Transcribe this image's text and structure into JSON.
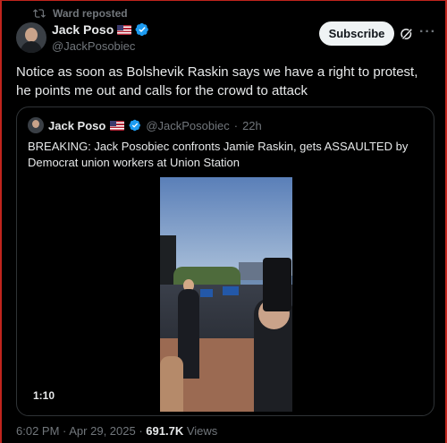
{
  "repost": {
    "text": "Ward reposted",
    "icon": "repost-icon"
  },
  "author": {
    "name": "Jack Poso",
    "handle": "@JackPosobiec",
    "flag": "🇺🇸",
    "verified": true
  },
  "actions": {
    "subscribe_label": "Subscribe",
    "grok_icon": "grok-icon",
    "more_label": "···"
  },
  "post": {
    "text": "Notice as soon as Bolshevik Raskin says we have a right to protest, he points me out and calls for the crowd to attack"
  },
  "quote": {
    "name": "Jack Poso",
    "handle": "@JackPosobiec",
    "separator": "·",
    "time": "22h",
    "text": "BREAKING: Jack Posobiec confronts Jamie Raskin, gets ASSAULTED by Democrat union workers at Union Station",
    "video_duration": "1:10"
  },
  "meta": {
    "time": "6:02 PM",
    "separator": " · ",
    "date": "Apr 29, 2025",
    "views_count": "691.7K",
    "views_label": "Views"
  },
  "colors": {
    "accent": "#1d9bf0",
    "text": "#e7e9ea",
    "muted": "#71767b",
    "border": "#2f3336"
  }
}
